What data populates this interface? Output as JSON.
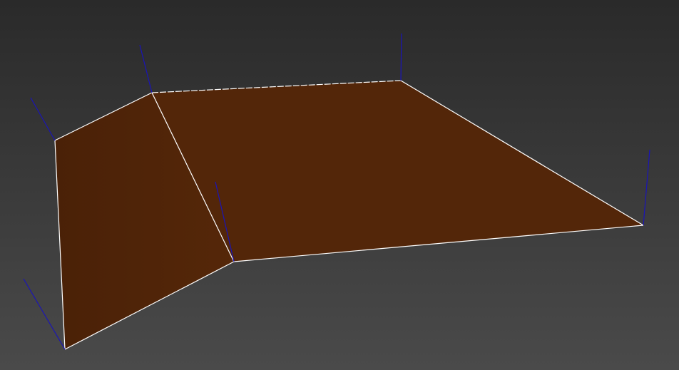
{
  "viewport": {
    "background_top": "#2a2a2a",
    "background_bottom": "#4a4a4a"
  },
  "mesh": {
    "face_color": "#532609",
    "face_color_side": "#4e2407",
    "edge_color": "#ffffff",
    "normal_color": "#1a14b8",
    "vertex_count": 6,
    "face_count": 2
  }
}
